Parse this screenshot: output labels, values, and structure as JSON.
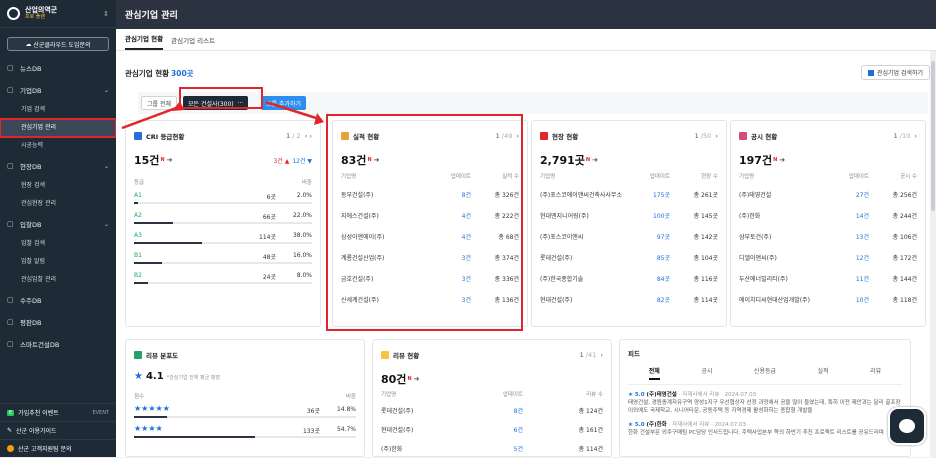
{
  "sidebar": {
    "org_title": "산업의역군",
    "org_sub": "프로 플랜",
    "cloud_button": "산군클라우드 도입문의",
    "menus": [
      {
        "label": "뉴스DB",
        "icon": "newspaper-icon",
        "expanded": false,
        "items": []
      },
      {
        "label": "기업DB",
        "icon": "building-icon",
        "expanded": true,
        "items": [
          "기업 검색",
          "관심기업 관리",
          "시공능력"
        ]
      },
      {
        "label": "현장DB",
        "icon": "location-icon",
        "expanded": true,
        "items": [
          "현장 검색",
          "관심현장 관리"
        ]
      },
      {
        "label": "입찰DB",
        "icon": "gavel-icon",
        "expanded": true,
        "items": [
          "입찰 검색",
          "입찰 알림",
          "관심입찰 관리"
        ]
      },
      {
        "label": "수주DB",
        "icon": "contract-icon",
        "expanded": false,
        "items": []
      },
      {
        "label": "평판DB",
        "icon": "rating-icon",
        "expanded": false,
        "items": []
      },
      {
        "label": "스마트건설DB",
        "icon": "smart-icon",
        "expanded": false,
        "items": []
      }
    ],
    "active_item": "관심기업 관리",
    "event_label": "가입추천 이벤트",
    "event_tag": "EVENT",
    "guide_label": "산군 이용가이드",
    "help_label": "산군 고객지원팀 문의"
  },
  "header": {
    "title": "관심기업 관리"
  },
  "tabs": [
    {
      "label": "관심기업 현황",
      "active": true
    },
    {
      "label": "관심기업 리스트",
      "active": false
    }
  ],
  "section": {
    "title": "관심기업 현황",
    "count": "300곳",
    "search_button": "관심기업 검색하기"
  },
  "filters": {
    "all": "그룹 전체",
    "selected": "모든 건설사(300)",
    "more": "···",
    "add": "그룹 추가하기"
  },
  "cards": {
    "cri": {
      "title": "CRI 등급현황",
      "page": "1",
      "page_total": "/ 2",
      "total": "15건",
      "new_mark": "N",
      "up": "3건 ▲",
      "down": "12건 ▼",
      "col1": "등급",
      "col2": "비중",
      "rows": [
        {
          "grade": "A1",
          "count": "6곳",
          "pct": "2.0%",
          "ratio": 0.02
        },
        {
          "grade": "A2",
          "count": "66곳",
          "pct": "22.0%",
          "ratio": 0.22
        },
        {
          "grade": "A3",
          "count": "114곳",
          "pct": "38.0%",
          "ratio": 0.38
        },
        {
          "grade": "B1",
          "count": "48곳",
          "pct": "16.0%",
          "ratio": 0.16
        },
        {
          "grade": "B2",
          "count": "24곳",
          "pct": "8.0%",
          "ratio": 0.08
        }
      ]
    },
    "perf": {
      "title": "실적 현황",
      "page": "1",
      "page_total": "/49",
      "total": "83건",
      "new_mark": "N",
      "cols": [
        "기업명",
        "업데이트",
        "실적 수"
      ],
      "rows": [
        [
          "동부건설(주)",
          "8건",
          "총 326건"
        ],
        [
          "지에스건설(주)",
          "4건",
          "총 222건"
        ],
        [
          "삼성이앤에이(주)",
          "4건",
          "총 68건"
        ],
        [
          "계룡건설산업(주)",
          "3건",
          "총 374건"
        ],
        [
          "금호건설(주)",
          "3건",
          "총 336건"
        ],
        [
          "신세계건설(주)",
          "3건",
          "총 136건"
        ]
      ]
    },
    "site": {
      "title": "현장 현황",
      "page": "1",
      "page_total": "/50",
      "total": "2,791곳",
      "new_mark": "N",
      "cols": [
        "기업명",
        "업데이트",
        "현장 수"
      ],
      "rows": [
        [
          "(주)포스코에이앤씨건축사사무소",
          "175곳",
          "총 261곳"
        ],
        [
          "현대엔지니어링(주)",
          "100곳",
          "총 145곳"
        ],
        [
          "(주)포스코이앤씨",
          "97곳",
          "총 142곳"
        ],
        [
          "롯데건설(주)",
          "85곳",
          "총 104곳"
        ],
        [
          "(주)한국종합기술",
          "84곳",
          "총 116곳"
        ],
        [
          "현대건설(주)",
          "82곳",
          "총 114곳"
        ]
      ]
    },
    "notice": {
      "title": "공시 현황",
      "page": "1",
      "page_total": "/10",
      "total": "197건",
      "new_mark": "N",
      "cols": [
        "기업명",
        "업데이트",
        "공시 수"
      ],
      "rows": [
        [
          "(주)태영건설",
          "27건",
          "총 256건"
        ],
        [
          "(주)한화",
          "14건",
          "총 244건"
        ],
        [
          "삼부토건(주)",
          "13건",
          "총 106건"
        ],
        [
          "디엘이앤씨(주)",
          "12건",
          "총 172건"
        ],
        [
          "두산에너빌리티(주)",
          "11건",
          "총 144건"
        ],
        [
          "에이치디씨현대산업개발(주)",
          "10건",
          "총 118건"
        ]
      ]
    },
    "review_dist": {
      "title": "리뷰 분포도",
      "score": "4.1",
      "note": "*관심기업 전체 평균 평점",
      "col1": "점수",
      "col2": "비중",
      "rows": [
        {
          "stars": "★★★★★",
          "count": "36곳",
          "pct": "14.8%",
          "ratio": 0.148
        },
        {
          "stars": "★★★★",
          "count": "133곳",
          "pct": "54.7%",
          "ratio": 0.547
        }
      ]
    },
    "review": {
      "title": "리뷰 현황",
      "page": "1",
      "page_total": "/41",
      "total": "80건",
      "new_mark": "N",
      "cols": [
        "기업명",
        "업데이트",
        "리뷰 수"
      ],
      "rows": [
        [
          "롯데건설(주)",
          "8건",
          "총 124건"
        ],
        [
          "현대건설(주)",
          "6건",
          "총 161건"
        ],
        [
          "(주)한화",
          "5건",
          "총 114건"
        ]
      ]
    },
    "feed": {
      "title": "피드",
      "tabs": [
        "전체",
        "공시",
        "신용등급",
        "실적",
        "리뷰"
      ],
      "items": [
        {
          "score": "★ 5.0",
          "company": "(주)태영건설",
          "meta": "· 자재사에서 리뷰 · 2024.07.03",
          "text": "태영건설, 경원종계자유구역 양성1지구 우선협상자 선정 과정에서 공을 많이 들였는데, 특히 이전 제안과는 달리 골프장 이외에도 국제학교, 시니어타운, 공동주택 등 지역경제 활성화하는 종합형 개발을"
        },
        {
          "score": "★ 5.0",
          "company": "(주)한화",
          "meta": "· 자재사에서 리뷰 · 2024.07.03",
          "text": "한화 건설부문 외주구매팀 PC담당 인사드립니다. 주택사업본부 쪽의 하반기 추진 프로젝트 리스트를 공유드리며"
        }
      ]
    }
  }
}
